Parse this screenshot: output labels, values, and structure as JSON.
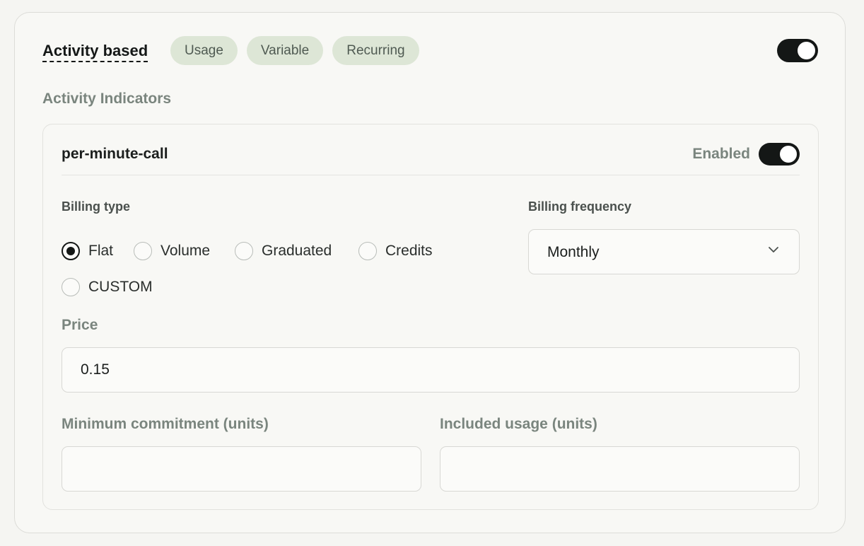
{
  "section": {
    "title": "Activity based",
    "tags": [
      "Usage",
      "Variable",
      "Recurring"
    ],
    "enabled": true
  },
  "indicators": {
    "heading": "Activity Indicators",
    "item": {
      "name": "per-minute-call",
      "status_label": "Enabled",
      "enabled": true,
      "billing_type": {
        "label": "Billing type",
        "options": [
          "Flat",
          "Volume",
          "Graduated",
          "Credits",
          "CUSTOM"
        ],
        "selected": "Flat"
      },
      "billing_frequency": {
        "label": "Billing frequency",
        "value": "Monthly"
      },
      "price": {
        "label": "Price",
        "value": "0.15"
      },
      "minimum_commitment": {
        "label": "Minimum commitment (units)",
        "value": ""
      },
      "included_usage": {
        "label": "Included usage (units)",
        "value": ""
      }
    }
  }
}
